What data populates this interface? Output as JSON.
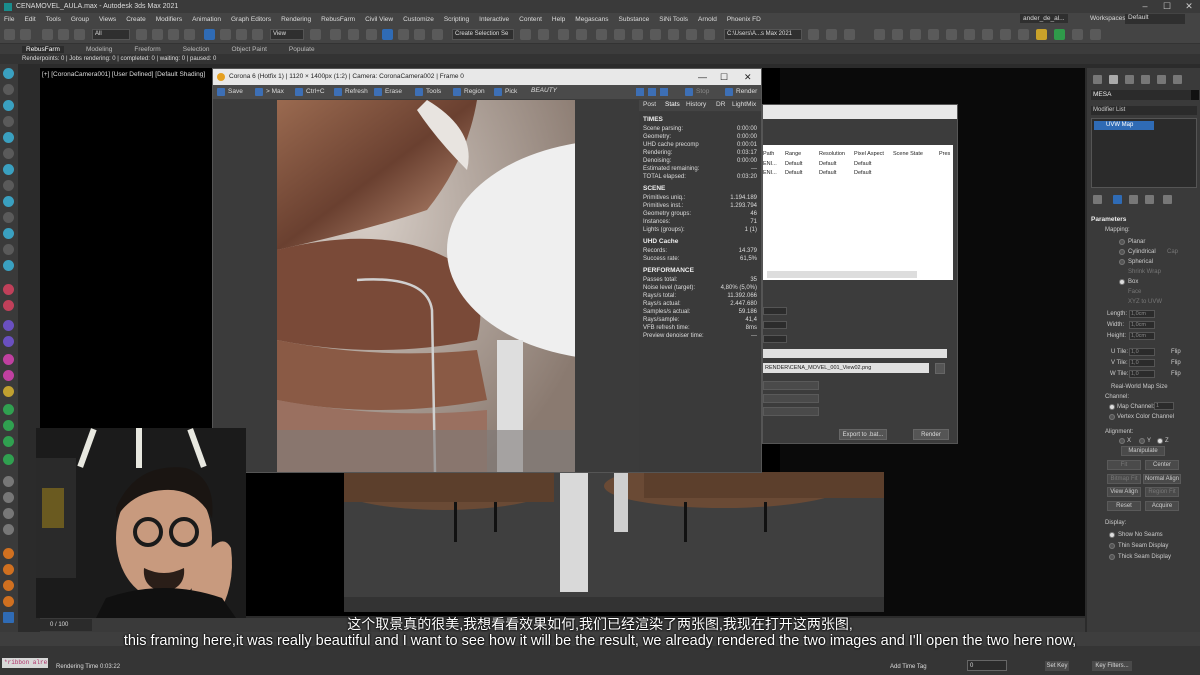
{
  "window": {
    "title": "CENAMOVEL_AULA.max - Autodesk 3ds Max 2021",
    "min": "–",
    "max": "☐",
    "close": "✕"
  },
  "menu": {
    "items": [
      "File",
      "Edit",
      "Tools",
      "Group",
      "Views",
      "Create",
      "Modifiers",
      "Animation",
      "Graph Editors",
      "Rendering",
      "RebusFarm",
      "Civil View",
      "Customize",
      "Scripting",
      "Interactive",
      "Content",
      "Help",
      "Megascans",
      "Substance",
      "SiNi Tools",
      "Arnold",
      "Phoenix FD"
    ],
    "user": "ander_de_al...",
    "workspaces_label": "Workspaces:",
    "workspaces_value": "Default"
  },
  "toolbar": {
    "filter": "All",
    "view": "View",
    "selection_set": "Create Selection Se",
    "project_path": "C:\\Users\\A...s Max 2021"
  },
  "ribbon": {
    "tabs": [
      "RebusFarm",
      "Modeling",
      "Freeform",
      "Selection",
      "Object Paint",
      "Populate"
    ],
    "status": "Renderpoints: 0 | Jobs rendering: 0 | completed: 0 | waiting: 0 | paused: 0"
  },
  "viewport": {
    "label": "[+] [CoronaCamera001] [User Defined] [Default Shading]"
  },
  "corona": {
    "title": "Corona 6 (Hotfix 1) | 1120 × 1400px (1:2) | Camera: CoronaCamera002 | Frame 0",
    "min": "—",
    "max": "☐",
    "close": "✕",
    "toolbar": {
      "save": "Save",
      "to_max": "> Max",
      "ctrl_c": "Ctrl+C",
      "refresh": "Refresh",
      "erase": "Erase",
      "tools": "Tools",
      "region": "Region",
      "pick": "Pick",
      "beauty": "BEAUTY",
      "stop": "Stop",
      "render": "Render"
    },
    "tabs": [
      "Post",
      "Stats",
      "History",
      "DR",
      "LightMix"
    ],
    "stats": {
      "times_header": "TIMES",
      "times": [
        {
          "label": "Scene parsing:",
          "value": "0:00:00"
        },
        {
          "label": "Geometry:",
          "value": "0:00:00"
        },
        {
          "label": "UHD cache precomp",
          "value": "0:00:01"
        },
        {
          "label": "Rendering:",
          "value": "0:03:17"
        },
        {
          "label": "Denoising:",
          "value": "0:00:00"
        },
        {
          "label": "Estimated remaining:",
          "value": "---"
        },
        {
          "label": "TOTAL elapsed:",
          "value": "0:03:20"
        }
      ],
      "scene_header": "SCENE",
      "scene": [
        {
          "label": "Primitives uniq.:",
          "value": "1.194.189"
        },
        {
          "label": "Primitives inst.:",
          "value": "1.293.794"
        },
        {
          "label": "Geometry groups:",
          "value": "46"
        },
        {
          "label": "Instances:",
          "value": "71"
        },
        {
          "label": "Lights (groups):",
          "value": "1 (1)"
        }
      ],
      "uhd_header": "UHD Cache",
      "uhd": [
        {
          "label": "Records:",
          "value": "14.379"
        },
        {
          "label": "Success rate:",
          "value": "61,5%"
        }
      ],
      "perf_header": "PERFORMANCE",
      "perf": [
        {
          "label": "Passes total:",
          "value": "35"
        },
        {
          "label": "Noise level (target):",
          "value": "4,80% (5,0%)"
        },
        {
          "label": "Rays/s total:",
          "value": "11.392.066"
        },
        {
          "label": "Rays/s actual:",
          "value": "2.447.680"
        },
        {
          "label": "Samples/s actual:",
          "value": "59.186"
        },
        {
          "label": "Rays/sample:",
          "value": "41,4"
        },
        {
          "label": "VFB refresh time:",
          "value": "8ms"
        },
        {
          "label": "Preview denoiser time:",
          "value": "---"
        }
      ]
    }
  },
  "render_setup": {
    "columns": [
      "Path",
      "Range",
      "Resolution",
      "Pixel Aspect",
      "Scene State",
      "Pres"
    ],
    "rows": [
      [
        "ENI...",
        "Default",
        "Default",
        "Default"
      ],
      [
        "ENI...",
        "Default",
        "Default",
        "Default"
      ]
    ],
    "output_path": "RENDER\\CENA_MOVEL_001_View02.png",
    "export_btn": "Export to .bat...",
    "render_btn": "Render"
  },
  "command_panel": {
    "object_name": "MESA",
    "modifier_list": "Modifier List",
    "modifier": "UVW Map",
    "parameters": "Parameters",
    "mapping_label": "Mapping:",
    "mapping_options": [
      "Planar",
      "Cylindrical",
      "Cap",
      "Spherical",
      "Shrink Wrap",
      "Box",
      "Face",
      "XYZ to UVW"
    ],
    "length_label": "Length:",
    "length": "1,0cm",
    "width_label": "Width:",
    "width": "1,0cm",
    "height_label": "Height:",
    "height": "1,0cm",
    "utile_label": "U Tile:",
    "utile": "1,0",
    "vtile_label": "V Tile:",
    "vtile": "1,0",
    "wtile_label": "W Tile:",
    "wtile": "1,0",
    "flip": "Flip",
    "real_world": "Real-World Map Size",
    "channel_label": "Channel:",
    "map_channel": "Map Channel:",
    "map_channel_value": "1",
    "vertex_color": "Vertex Color Channel",
    "alignment": "Alignment:",
    "ax_x": "X",
    "ax_y": "Y",
    "ax_z": "Z",
    "btn_manipulate": "Manipulate",
    "btn_fit": "Fit",
    "btn_center": "Center",
    "btn_bitmap_fit": "Bitmap Fit",
    "btn_normal_align": "Normal Align",
    "btn_view_align": "View Align",
    "btn_region_fit": "Region Fit",
    "btn_reset": "Reset",
    "btn_acquire": "Acquire",
    "display_label": "Display:",
    "display_options": [
      "Show No Seams",
      "Thin Seam Display",
      "Thick Seam Display"
    ]
  },
  "bottom": {
    "time_slider": "0 / 100",
    "maxscript": "*ribbon alre",
    "rendering_time": "Rendering Time 0:03:22",
    "add_time_tag": "Add Time Tag",
    "frame": "0",
    "set_key": "Set Key",
    "key_filters": "Key Filters..."
  },
  "subtitles": {
    "cn": "这个取景真的很美,我想看看效果如何,我们已经渲染了两张图,我现在打开这两张图,",
    "en": "this framing here,it was really beautiful and I want to see how it will be the result, we already rendered the two images and I'll open the two here now,"
  }
}
